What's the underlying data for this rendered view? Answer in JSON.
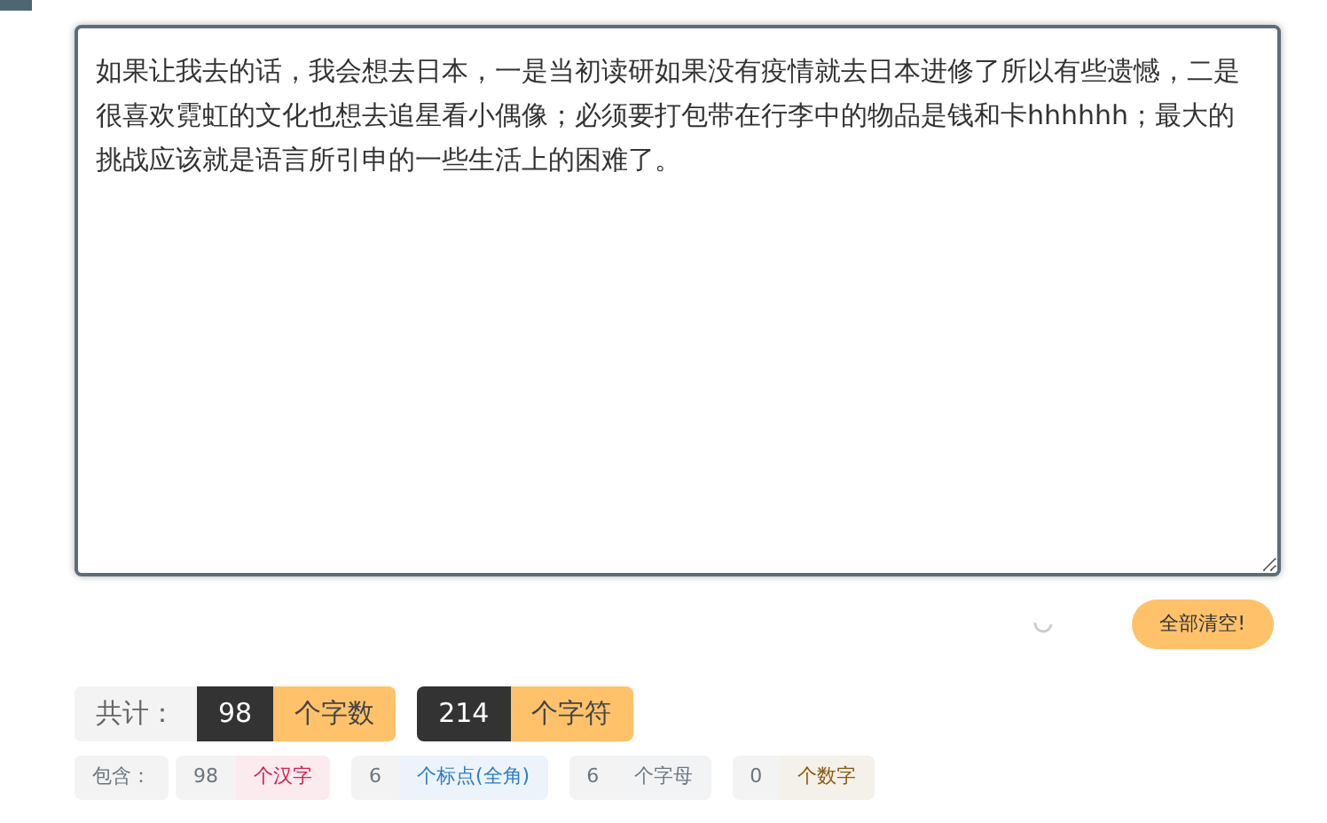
{
  "editor": {
    "value": "如果让我去的话，我会想去日本，一是当初读研如果没有疫情就去日本进修了所以有些遗憾，二是很喜欢霓虹的文化也想去追星看小偶像；必须要打包带在行李中的物品是钱和卡hhhhhh；最大的挑战应该就是语言所引申的一些生活上的困难了。"
  },
  "clear_button": {
    "label": "全部清空!"
  },
  "totals": {
    "label": "共计：",
    "items": [
      {
        "value": "98",
        "unit": "个字数"
      },
      {
        "value": "214",
        "unit": "个字符"
      }
    ]
  },
  "details": {
    "label": "包含：",
    "items": [
      {
        "value": "98",
        "unit": "个汉字",
        "color": "#d6204f"
      },
      {
        "value": "6",
        "unit": "个标点(全角)",
        "color": "#2f7dc4"
      },
      {
        "value": "6",
        "unit": "个字母",
        "color": "#6c7a86"
      },
      {
        "value": "0",
        "unit": "个数字",
        "color": "#8a5a12"
      }
    ]
  }
}
